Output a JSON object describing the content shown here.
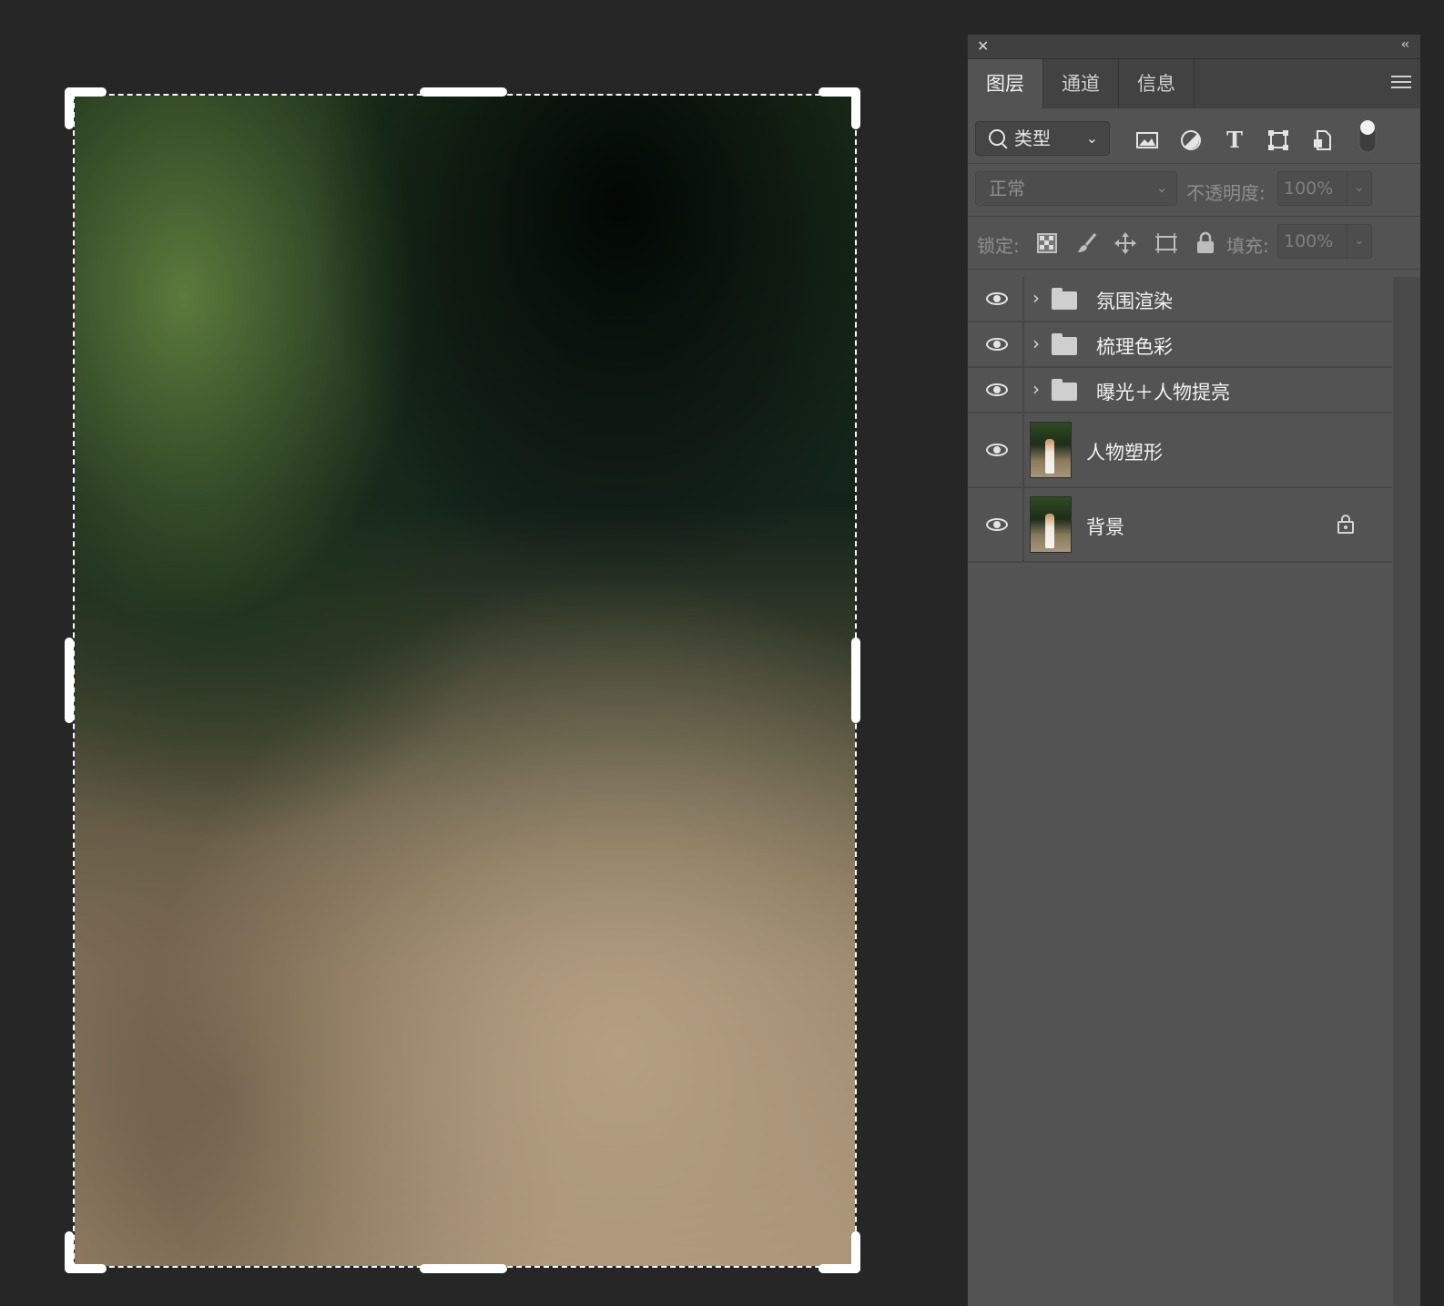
{
  "panel": {
    "tabs": [
      {
        "label": "图层",
        "active": true
      },
      {
        "label": "通道",
        "active": false
      },
      {
        "label": "信息",
        "active": false
      }
    ],
    "filter": {
      "kind_label": "类型"
    },
    "blend_mode": "正常",
    "opacity_label": "不透明度:",
    "opacity_value": "100%",
    "lock_label": "锁定:",
    "fill_label": "填充:",
    "fill_value": "100%",
    "layers": [
      {
        "name": "氛围渲染",
        "type": "group",
        "visible": true
      },
      {
        "name": "梳理色彩",
        "type": "group",
        "visible": true
      },
      {
        "name": "曝光＋人物提亮",
        "type": "group",
        "visible": true
      },
      {
        "name": "人物塑形",
        "type": "pixel",
        "visible": true
      },
      {
        "name": "背景",
        "type": "pixel",
        "visible": true,
        "locked": true
      }
    ]
  },
  "icons": {
    "close": "close-icon",
    "collapse": "double-chevron-left-icon",
    "panel_menu": "hamburger-menu-icon",
    "filters": [
      "image-filter-icon",
      "adjustment-filter-icon",
      "type-filter-icon",
      "shape-filter-icon",
      "smart-object-filter-icon",
      "filter-toggle-icon"
    ],
    "locks": [
      "lock-transparent-pixels-icon",
      "lock-image-pixels-icon",
      "lock-position-icon",
      "lock-artboard-icon",
      "lock-all-icon"
    ]
  },
  "colors": {
    "canvas_bg": "#262626",
    "panel_bg": "#535353",
    "tab_bar_bg": "#424242"
  }
}
